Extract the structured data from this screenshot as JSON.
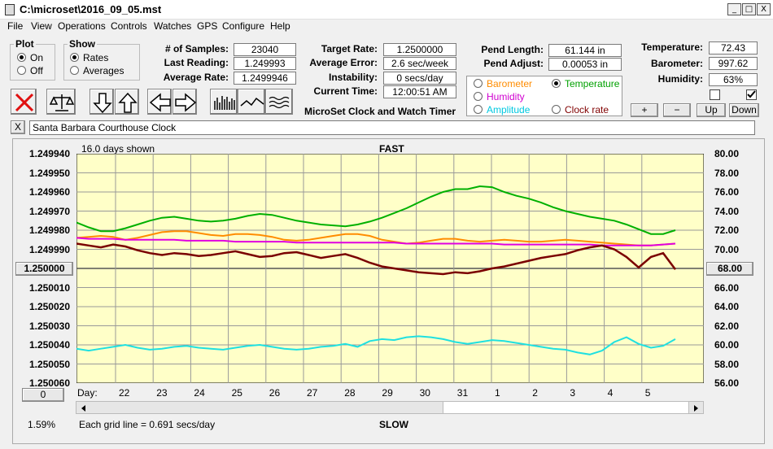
{
  "window": {
    "title": "C:\\microset\\2016_09_05.mst",
    "minimize": "_",
    "maximize": "□",
    "close": "X"
  },
  "menu": [
    "File",
    "View",
    "Operations",
    "Controls",
    "Watches",
    "GPS",
    "Configure",
    "Help"
  ],
  "plot_group": {
    "legend": "Plot",
    "options": [
      "On",
      "Off"
    ],
    "selected": "On"
  },
  "show_group": {
    "legend": "Show",
    "options": [
      "Rates",
      "Averages"
    ],
    "selected": "Rates"
  },
  "stats": {
    "samples_label": "# of Samples:",
    "samples_value": "23040",
    "last_reading_label": "Last Reading:",
    "last_reading_value": "1.249993",
    "average_rate_label": "Average Rate:",
    "average_rate_value": "1.2499946"
  },
  "targets": {
    "target_rate_label": "Target Rate:",
    "target_rate_value": "1.2500000",
    "average_error_label": "Average Error:",
    "average_error_value": "2.6 sec/week",
    "instability_label": "Instability:",
    "instability_value": "0 secs/day",
    "current_time_label": "Current Time:",
    "current_time_value": "12:00:51 AM"
  },
  "product_label": "MicroSet Clock and Watch Timer",
  "pendulum": {
    "length_label": "Pend Length:",
    "length_value": "61.144 in",
    "adjust_label": "Pend Adjust:",
    "adjust_value": "0.00053 in"
  },
  "environment": {
    "temperature_label": "Temperature:",
    "temperature_value": "72.43",
    "barometer_label": "Barometer:",
    "barometer_value": "997.62",
    "humidity_label": "Humidity:",
    "humidity_value": "63%"
  },
  "right_plot_selector": {
    "options": [
      {
        "label": "Barometer",
        "color": "#ff8c00",
        "selected": false
      },
      {
        "label": "Temperature",
        "color": "#00a000",
        "selected": true
      },
      {
        "label": "Humidity",
        "color": "#d000d0",
        "selected": false
      },
      {
        "label": "Clock rate",
        "color": "#800000",
        "selected": false
      },
      {
        "label": "Amplitude",
        "color": "#00c8e0",
        "selected": false
      }
    ]
  },
  "axis_buttons": {
    "plus": "+",
    "minus": "−",
    "up": "Up",
    "down": "Down"
  },
  "checkboxes": [
    {
      "checked": false
    },
    {
      "checked": true
    }
  ],
  "toolbar_icons": [
    "stop-icon",
    "balance-icon",
    "arrow-down-icon",
    "arrow-up-icon",
    "arrow-left-icon",
    "arrow-right-icon",
    "histogram-icon",
    "wave-icon",
    "multi-wave-icon"
  ],
  "clock_name": "Santa Barbara Courthouse Clock",
  "clock_close": "X",
  "chart": {
    "days_shown": "16.0 days shown",
    "top_label": "FAST",
    "bottom_label": "SLOW",
    "grid_note": "Each grid line = 0.691 secs/day",
    "percent": "1.59%",
    "left_button": "1.250000",
    "left_bottom_button": "0",
    "right_button": "68.00",
    "day_label": "Day:"
  },
  "chart_data": {
    "type": "line",
    "left_axis_ticks": [
      "1.249940",
      "1.249950",
      "1.249960",
      "1.249970",
      "1.249980",
      "1.249990",
      "1.250000",
      "1.250010",
      "1.250020",
      "1.250030",
      "1.250040",
      "1.250050",
      "1.250060"
    ],
    "right_axis_ticks": [
      "80.00",
      "78.00",
      "76.00",
      "74.00",
      "72.00",
      "70.00",
      "68.00",
      "66.00",
      "64.00",
      "62.00",
      "60.00",
      "58.00",
      "56.00"
    ],
    "ylim_left": [
      1.24994,
      1.25006
    ],
    "ylim_right": [
      56,
      80
    ],
    "x_labels": [
      "22",
      "23",
      "24",
      "25",
      "26",
      "27",
      "28",
      "29",
      "30",
      "31",
      "1",
      "2",
      "3",
      "4",
      "5"
    ],
    "grid": true,
    "background": "#ffffc8",
    "series": [
      {
        "color": "#00b000",
        "values": [
          72.8,
          72.3,
          71.9,
          71.9,
          72.2,
          72.6,
          73.0,
          73.3,
          73.4,
          73.2,
          73.0,
          72.9,
          73.0,
          73.2,
          73.5,
          73.7,
          73.6,
          73.3,
          73.0,
          72.8,
          72.6,
          72.5,
          72.4,
          72.6,
          72.9,
          73.3,
          73.8,
          74.3,
          74.9,
          75.5,
          76.0,
          76.3,
          76.3,
          76.6,
          76.5,
          76.0,
          75.6,
          75.3,
          74.9,
          74.4,
          74.0,
          73.7,
          73.4,
          73.2,
          73.0,
          72.6,
          72.1,
          71.6,
          71.6,
          72.0
        ]
      },
      {
        "color": "#ff8c00",
        "values": [
          71.2,
          71.3,
          71.4,
          71.3,
          71.0,
          71.2,
          71.5,
          71.8,
          71.9,
          71.9,
          71.7,
          71.5,
          71.4,
          71.6,
          71.6,
          71.5,
          71.3,
          71.0,
          70.9,
          71.0,
          71.2,
          71.4,
          71.6,
          71.6,
          71.4,
          71.0,
          70.8,
          70.6,
          70.7,
          70.9,
          71.1,
          71.1,
          70.9,
          70.8,
          70.9,
          71.0,
          70.9,
          70.8,
          70.8,
          70.9,
          71.0,
          70.9,
          70.8,
          70.7,
          70.6,
          70.5,
          70.4,
          70.4,
          70.5,
          70.6
        ]
      },
      {
        "color": "#e000e0",
        "values": [
          71.2,
          71.1,
          71.1,
          71.1,
          71.0,
          71.0,
          71.0,
          71.0,
          71.0,
          70.9,
          70.9,
          70.9,
          70.9,
          70.8,
          70.8,
          70.8,
          70.8,
          70.8,
          70.7,
          70.7,
          70.7,
          70.7,
          70.7,
          70.7,
          70.7,
          70.7,
          70.7,
          70.6,
          70.6,
          70.6,
          70.6,
          70.6,
          70.6,
          70.6,
          70.6,
          70.5,
          70.5,
          70.5,
          70.5,
          70.5,
          70.5,
          70.5,
          70.5,
          70.4,
          70.4,
          70.4,
          70.4,
          70.4,
          70.5,
          70.6
        ]
      },
      {
        "color": "#7a0000",
        "values": [
          70.6,
          70.4,
          70.2,
          70.5,
          70.3,
          69.9,
          69.6,
          69.4,
          69.6,
          69.5,
          69.3,
          69.4,
          69.6,
          69.8,
          69.5,
          69.2,
          69.3,
          69.6,
          69.7,
          69.4,
          69.1,
          69.3,
          69.5,
          69.1,
          68.6,
          68.2,
          68.0,
          67.8,
          67.6,
          67.5,
          67.4,
          67.6,
          67.5,
          67.7,
          68.0,
          68.2,
          68.5,
          68.8,
          69.1,
          69.3,
          69.5,
          69.9,
          70.2,
          70.4,
          70.0,
          69.2,
          68.1,
          69.2,
          69.6,
          67.9
        ]
      },
      {
        "color": "#20e0e0",
        "values": [
          59.6,
          59.4,
          59.6,
          59.8,
          60.0,
          59.7,
          59.5,
          59.6,
          59.8,
          59.9,
          59.7,
          59.6,
          59.5,
          59.7,
          59.9,
          60.0,
          59.8,
          59.6,
          59.5,
          59.6,
          59.8,
          59.9,
          60.1,
          59.8,
          60.4,
          60.6,
          60.5,
          60.8,
          60.9,
          60.8,
          60.6,
          60.3,
          60.1,
          60.3,
          60.5,
          60.4,
          60.2,
          60.0,
          59.8,
          59.6,
          59.5,
          59.2,
          59.0,
          59.4,
          60.3,
          60.8,
          60.1,
          59.7,
          59.9,
          60.6
        ]
      }
    ]
  }
}
